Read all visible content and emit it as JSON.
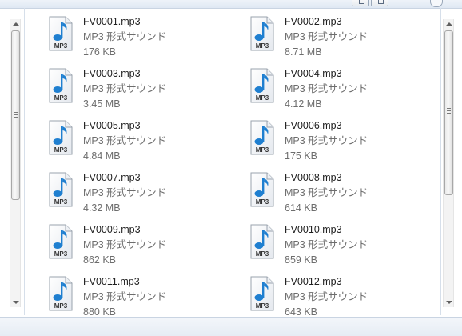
{
  "files": [
    {
      "name": "FV0001.mp3",
      "type": "MP3 形式サウンド",
      "size": "176 KB",
      "icon": "mp3-file-icon",
      "icon_label": "MP3"
    },
    {
      "name": "FV0002.mp3",
      "type": "MP3 形式サウンド",
      "size": "8.71 MB",
      "icon": "mp3-file-icon",
      "icon_label": "MP3"
    },
    {
      "name": "FV0003.mp3",
      "type": "MP3 形式サウンド",
      "size": "3.45 MB",
      "icon": "mp3-file-icon",
      "icon_label": "MP3"
    },
    {
      "name": "FV0004.mp3",
      "type": "MP3 形式サウンド",
      "size": "4.12 MB",
      "icon": "mp3-file-icon",
      "icon_label": "MP3"
    },
    {
      "name": "FV0005.mp3",
      "type": "MP3 形式サウンド",
      "size": "4.84 MB",
      "icon": "mp3-file-icon",
      "icon_label": "MP3"
    },
    {
      "name": "FV0006.mp3",
      "type": "MP3 形式サウンド",
      "size": "175 KB",
      "icon": "mp3-file-icon",
      "icon_label": "MP3"
    },
    {
      "name": "FV0007.mp3",
      "type": "MP3 形式サウンド",
      "size": "4.32 MB",
      "icon": "mp3-file-icon",
      "icon_label": "MP3"
    },
    {
      "name": "FV0008.mp3",
      "type": "MP3 形式サウンド",
      "size": "614 KB",
      "icon": "mp3-file-icon",
      "icon_label": "MP3"
    },
    {
      "name": "FV0009.mp3",
      "type": "MP3 形式サウンド",
      "size": "862 KB",
      "icon": "mp3-file-icon",
      "icon_label": "MP3"
    },
    {
      "name": "FV0010.mp3",
      "type": "MP3 形式サウンド",
      "size": "859 KB",
      "icon": "mp3-file-icon",
      "icon_label": "MP3"
    },
    {
      "name": "FV0011.mp3",
      "type": "MP3 形式サウンド",
      "size": "880 KB",
      "icon": "mp3-file-icon",
      "icon_label": "MP3"
    },
    {
      "name": "FV0012.mp3",
      "type": "MP3 形式サウンド",
      "size": "643 KB",
      "icon": "mp3-file-icon",
      "icon_label": "MP3"
    }
  ],
  "colors": {
    "note": "#1f7fd0",
    "name_text": "#1f1f1f",
    "meta_text": "#6d6d6d"
  }
}
